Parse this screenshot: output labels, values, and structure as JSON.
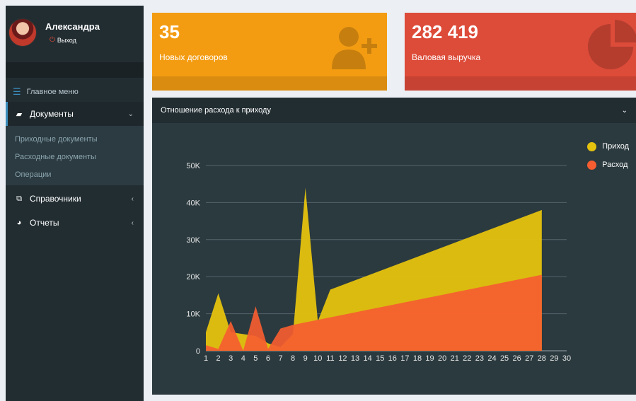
{
  "user": {
    "name": "Александра",
    "logout_label": "Выход"
  },
  "sidebar": {
    "header": "Главное меню",
    "items": [
      {
        "label": "Документы",
        "icon": "book-icon"
      },
      {
        "label": "Справочники",
        "icon": "copy-icon"
      },
      {
        "label": "Отчеты",
        "icon": "pie-chart-icon"
      }
    ],
    "submenu": [
      "Приходные документы",
      "Расходные документы",
      "Операции"
    ]
  },
  "stats": [
    {
      "value": "35",
      "label": "Новых договоров",
      "color": "#f39c12",
      "icon": "user-plus-icon"
    },
    {
      "value": "282 419",
      "label": "Валовая выручка",
      "color": "#dd4b39",
      "icon": "pie-chart-icon"
    }
  ],
  "chart_box": {
    "title": "Отношение расхода к приходу"
  },
  "chart_data": {
    "type": "area",
    "x": [
      1,
      2,
      3,
      4,
      5,
      6,
      7,
      8,
      9,
      10,
      11,
      12,
      13,
      14,
      15,
      16,
      17,
      18,
      19,
      20,
      21,
      22,
      23,
      24,
      25,
      26,
      27,
      28,
      29,
      30
    ],
    "series": [
      {
        "name": "Приход",
        "color": "#e5c20e",
        "points": [
          [
            1,
            5000
          ],
          [
            2,
            15500
          ],
          [
            3,
            5000
          ],
          [
            4,
            4500
          ],
          [
            5,
            4000
          ],
          [
            6,
            2000
          ],
          [
            7,
            1000
          ],
          [
            8,
            4500
          ],
          [
            9,
            44000
          ],
          [
            10,
            8000
          ],
          [
            11,
            16500
          ],
          [
            28,
            38000
          ]
        ]
      },
      {
        "name": "Расход",
        "color": "#f65d30",
        "points": [
          [
            1,
            1500
          ],
          [
            2,
            500
          ],
          [
            3,
            8000
          ],
          [
            4,
            0
          ],
          [
            5,
            12000
          ],
          [
            6,
            500
          ],
          [
            7,
            6000
          ],
          [
            8,
            7000
          ],
          [
            28,
            20500
          ]
        ]
      }
    ],
    "yticks": [
      "0",
      "10K",
      "20K",
      "30K",
      "40K",
      "50K"
    ],
    "ylim": [
      0,
      50000
    ],
    "xlim": [
      1,
      30
    ],
    "legend_position": "top-right",
    "grid": true
  }
}
